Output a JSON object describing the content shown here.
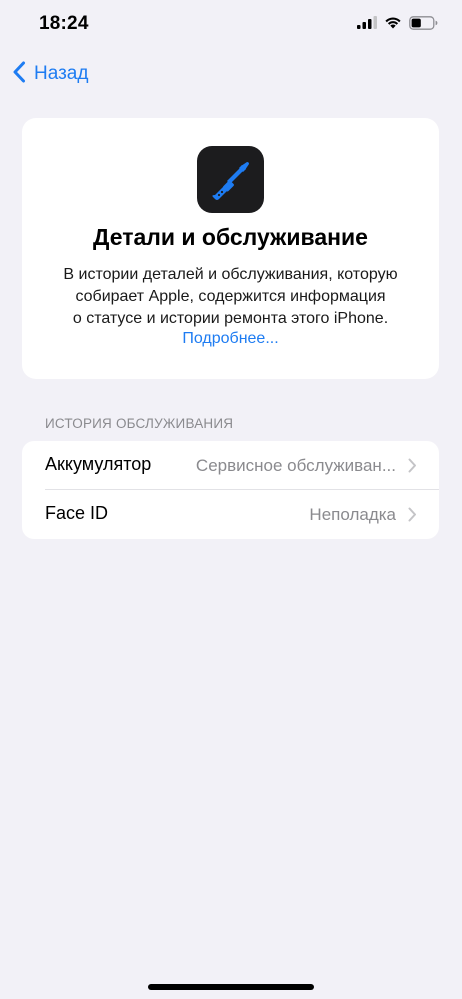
{
  "status_bar": {
    "time": "18:24",
    "icons": [
      "cellular-signal-icon",
      "wifi-icon",
      "battery-icon"
    ],
    "battery_level": 0.45
  },
  "nav": {
    "back_label": "Назад",
    "back_icon": "chevron-left-icon"
  },
  "info_card": {
    "icon": "screwdriver-icon",
    "title": "Детали и обслуживание",
    "description_lines": [
      "В истории деталей и обслуживания, которую",
      "собирает Apple, содержится информация",
      "о статусе и истории ремонта этого iPhone."
    ],
    "link_label": "Подробнее..."
  },
  "service_history": {
    "header": "ИСТОРИЯ ОБСЛУЖИВАНИЯ",
    "rows": [
      {
        "label": "Аккумулятор",
        "value": "Сервисное обслуживан..."
      },
      {
        "label": "Face ID",
        "value": "Неполадка"
      }
    ]
  },
  "colors": {
    "accent": "#1E7CF2",
    "background": "#F2F1F7",
    "card": "#FFFFFF",
    "secondary_text": "#8A8A8E"
  }
}
